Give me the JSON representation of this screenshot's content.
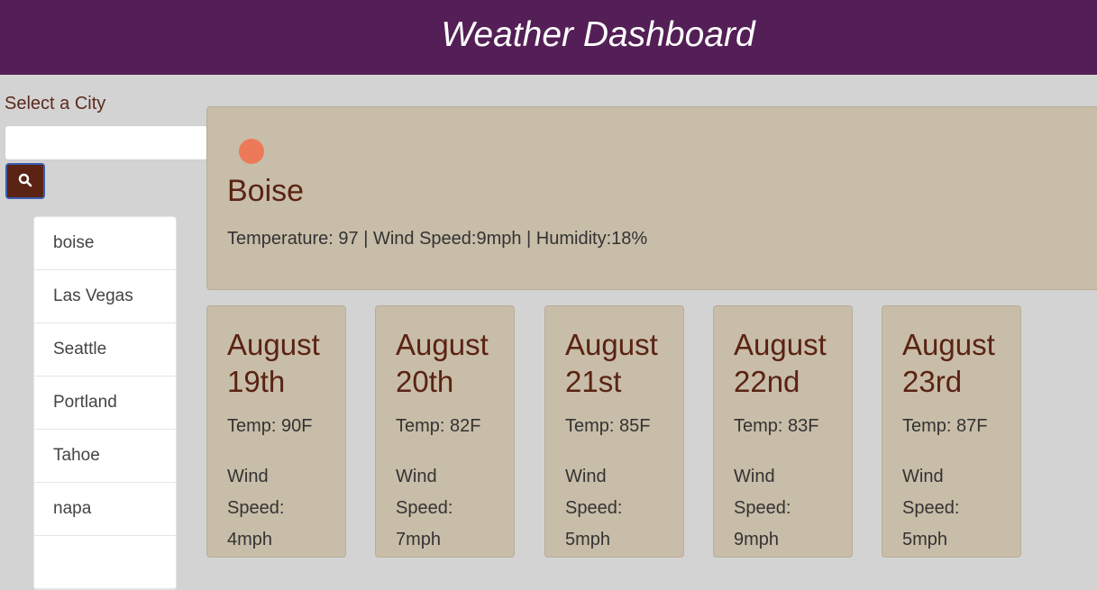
{
  "header": {
    "title": "Weather Dashboard"
  },
  "sidebar": {
    "label": "Select a City",
    "search_value": "",
    "search_icon": "search-icon",
    "cities": [
      "boise",
      "Las Vegas",
      "Seattle",
      "Portland",
      "Tahoe",
      "napa"
    ]
  },
  "current": {
    "icon": "sun-icon",
    "icon_color": "#ec7958",
    "city": "Boise",
    "stats": "Temperature: 97 | Wind Speed:9mph | Humidity:18%"
  },
  "forecast": [
    {
      "date": "August 19th",
      "temp": "Temp: 90F",
      "wind": "Wind Speed: 4mph"
    },
    {
      "date": "August 20th",
      "temp": "Temp: 82F",
      "wind": "Wind Speed: 7mph"
    },
    {
      "date": "August 21st",
      "temp": "Temp: 85F",
      "wind": "Wind Speed: 5mph"
    },
    {
      "date": "August 22nd",
      "temp": "Temp: 83F",
      "wind": "Wind Speed: 9mph"
    },
    {
      "date": "August 23rd",
      "temp": "Temp: 87F",
      "wind": "Wind Speed: 5mph"
    }
  ],
  "colors": {
    "header_bg": "#531f56",
    "card_bg": "#c8bda8",
    "accent_text": "#5a2313",
    "page_bg": "#d4d3d4"
  }
}
